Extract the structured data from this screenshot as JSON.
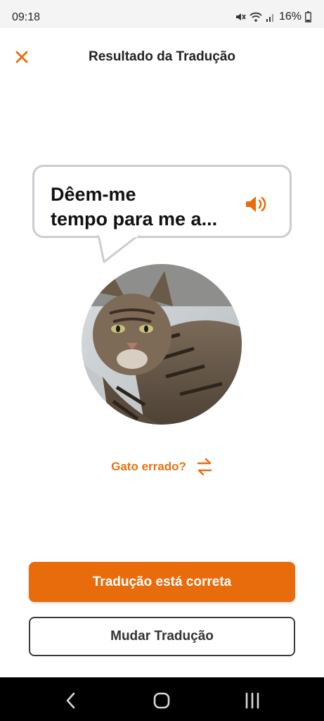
{
  "status_bar": {
    "time": "09:18",
    "battery": "16%",
    "icons": [
      "mute-icon",
      "wifi-icon",
      "signal-icon",
      "battery-icon"
    ]
  },
  "header": {
    "title": "Resultado da Tradução",
    "close_icon": "close-icon"
  },
  "translation": {
    "text_line1": "Dêem-me",
    "text_line2": "tempo para me a...",
    "speaker_icon": "speaker-icon"
  },
  "wrong_cat": {
    "label": "Gato errado?",
    "icon": "swap-icon"
  },
  "buttons": {
    "correct": "Tradução está correta",
    "change": "Mudar Tradução"
  },
  "colors": {
    "accent": "#e86c0c",
    "accent_text": "#e4730f",
    "bubble_border": "#c9ccd1"
  },
  "nav": {
    "icons": [
      "back-icon",
      "home-icon",
      "recents-icon"
    ]
  }
}
